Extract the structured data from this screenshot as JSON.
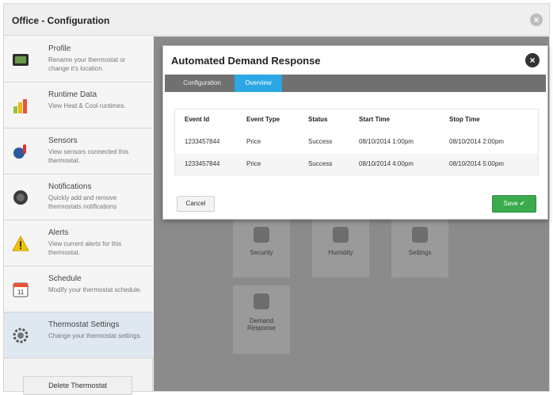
{
  "window": {
    "title": "Office - Configuration",
    "close_icon": "close-icon"
  },
  "sidebar": {
    "items": [
      {
        "title": "Profile",
        "desc": "Rename your thermostat or change it's location.",
        "icon": "profile-icon",
        "active": false
      },
      {
        "title": "Runtime Data",
        "desc": "View Heat & Cool runtimes.",
        "icon": "bar-chart-icon",
        "active": false
      },
      {
        "title": "Sensors",
        "desc": "View sensors connected this thermostat.",
        "icon": "sensor-icon",
        "active": false
      },
      {
        "title": "Notifications",
        "desc": "Quickly add and remove thermostats notifications",
        "icon": "notification-icon",
        "active": false
      },
      {
        "title": "Alerts",
        "desc": "View current alerts for this thermostat.",
        "icon": "warning-icon",
        "active": false
      },
      {
        "title": "Schedule",
        "desc": "Modify your thermostat schedule.",
        "icon": "calendar-icon",
        "active": false
      },
      {
        "title": "Thermostat Settings",
        "desc": "Change your thermostat settings.",
        "icon": "gear-icon",
        "active": true
      }
    ],
    "delete_label": "Delete Thermostat"
  },
  "tiles": [
    {
      "label": "Security",
      "icon": "security-icon"
    },
    {
      "label": "Humidity",
      "icon": "humidity-icon"
    },
    {
      "label": "Settings",
      "icon": "settings-icon"
    },
    {
      "label": "Demand Response",
      "icon": "demand-response-icon"
    }
  ],
  "modal": {
    "title": "Automated Demand Response",
    "close_icon": "close-icon",
    "tabs": [
      {
        "label": "Configuration",
        "active": false
      },
      {
        "label": "Overview",
        "active": true
      }
    ],
    "table": {
      "columns": [
        "Event Id",
        "Event Type",
        "Status",
        "Start Time",
        "Stop Time"
      ],
      "rows": [
        [
          "1233457844",
          "Price",
          "Success",
          "08/10/2014 1:00pm",
          "08/10/2014 2:00pm"
        ],
        [
          "1233457844",
          "Price",
          "Success",
          "08/10/2014 4:00pm",
          "08/10/2014 5:00pm"
        ]
      ]
    },
    "cancel_label": "Cancel",
    "save_label": "Save ✔"
  },
  "colors": {
    "tab_active": "#2ba7e3",
    "save_button": "#3bab4d",
    "overlay": "#8b8b8b"
  }
}
